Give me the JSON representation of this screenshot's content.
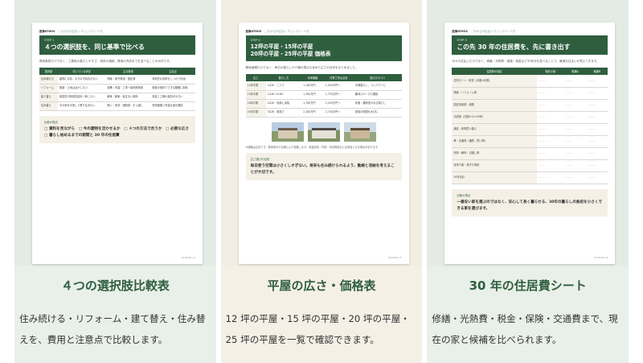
{
  "cards": [
    {
      "title": "４つの選択肢比較表",
      "desc": "住み続ける・リフォーム・建て替え・住み替えを、費用と注意点で比較します。",
      "doc": {
        "brand": "医療ATHOS",
        "tag": "これからの住まい チェックシート付",
        "step": "STEP 1",
        "heading": "４つの選択肢を、同じ基準で比べる",
        "lead": "費用負担だけでなく、工期後の暮らしやすさ、将来の相続、費用の内訳までを並べることが大切です。",
        "table": {
          "headers": [
            "選択肢",
            "向いている状況",
            "主な費用",
            "注意点"
          ],
          "rows": [
            [
              "住み続ける",
              "建物に劣化、大きな不具合がない",
              "修繕・保守費用・固定費",
              "将来的な改修をしっかり計画"
            ],
            [
              "リフォーム",
              "構造・土地は活かしたい",
              "設備・内装・工事一部改修費用",
              "構造の現状でできる範囲に制約"
            ],
            [
              "建て替え",
              "耐震性や断熱性能を一新したい",
              "解体・新築・仮住まい費用",
              "資金と工期の負担が大きい"
            ],
            [
              "住み替え",
              "今の家を手放して移り住みたい",
              "購入・売却・諸費用・引っ越し",
              "売却価格と資金計画を確認"
            ]
          ]
        },
        "note_title": "比較の視点",
        "note_body": "□ 資料を見ながら　□ 今の建物を活かせるか　□ ４つの方法で合うか　□ 必要な広さ　□ 暮らし始めるまでの期間と 30 年の住居費",
        "page": "RYOKAN | 4"
      }
    },
    {
      "title": "平屋の広さ・価格表",
      "desc": "12 坪の平屋・15 坪の平屋・20 坪の平屋・25 坪の平屋を一覧で確認できます。",
      "doc": {
        "brand": "医療ATHOS",
        "tag": "これからの住まい チェックシート付",
        "step": "STEP 2",
        "heading": "12坪の平屋・15坪の平屋\n20坪の平屋・25坪の平屋 価格表",
        "lead": "敷地面積だけでなく、毎日の暮らしや介護の視点も含めた広さの目安をまとめました。",
        "table": {
          "headers": [
            "広さ",
            "暮らし方",
            "本体価格",
            "付帯工事込目安",
            "選び方のコツ"
          ],
          "rows": [
            [
              "12坪平屋",
              "1LDK・二人で",
              "1,180万円",
              "1,500万円〜",
              "夫婦暮らし、コンパクトに"
            ],
            [
              "15坪平屋",
              "1LDK〜2LDK",
              "1,380万円",
              "1,750万円〜",
              "趣味スペースも確保"
            ],
            [
              "20坪平屋",
              "2LDK・収納に余裕",
              "1,780万円",
              "2,250万円〜",
              "来客・趣味室のある暮らし"
            ],
            [
              "25坪平屋",
              "3LDK・家族で",
              "2,180万円",
              "2,700万円〜",
              "家族の時間を大切に"
            ]
          ]
        },
        "caption": "※価格は目安です。敷地条件や仕様により変動します。地盤改良・外構・申請費用などは別途となる場合があります。",
        "note_title": "広さ選びの目安",
        "note_body": "毎日使う空間は小さくしすぎない。将来も住み続けられるよう、動線と収納を考えることが大切です。",
        "page": "RYOKAN | 5"
      }
    },
    {
      "title": "30 年の住居費シート",
      "desc": "修繕・光熱費・税金・保険・交通費まで、現在の家と候補を比べられます。",
      "doc": {
        "brand": "医療ATHOS",
        "tag": "これからの住まい チェックシート付",
        "step": "STEP 3",
        "heading": "この先 30 年の住居費を、先に書き出す",
        "lead": "月々の支払いだけでなく、修繕・光熱費・保険・税金など30年分を並べることで、最適な住まいが見えてきます。",
        "table": {
          "headers": [
            "住居費の項目",
            "現在の家",
            "候補A",
            "候補B"
          ],
          "rows": [
            [
              "住宅ローン・家賃（月額×年数）",
              "",
              "",
              ""
            ],
            [
              "修繕・リフォーム費",
              "",
              "",
              ""
            ],
            [
              "固定資産税・保険",
              "",
              "",
              ""
            ],
            [
              "光熱費（月額×12×30年）",
              "",
              "",
              ""
            ],
            [
              "通信・家電買い替え",
              "",
              "",
              ""
            ],
            [
              "車・交通費（通院・買い物）",
              "",
              "",
              ""
            ],
            [
              "売却・解体・引越し費",
              "",
              "",
              ""
            ],
            [
              "将来介護・見守り費用",
              "",
              "",
              ""
            ],
            [
              "30年合計",
              "",
              "",
              ""
            ]
          ]
        },
        "blank": "--------",
        "note_title": "比較の視点",
        "note_body": "一番安い家を選ぶのではなく、安心して長く暮らせる、30年の暮らしの負担を小さくできる家を選びます。",
        "page": "RYOKAN | 6"
      }
    }
  ]
}
